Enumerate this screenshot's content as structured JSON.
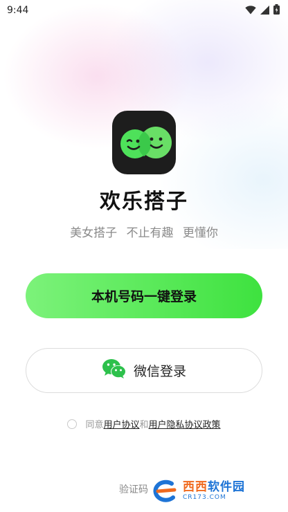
{
  "status_bar": {
    "time": "9:44",
    "icons": [
      "wifi-icon",
      "cellular-signal-icon",
      "battery-icon"
    ]
  },
  "app": {
    "logo": "app-logo-two-smiley-faces",
    "name": "欢乐搭子",
    "tagline": "美女搭子 不止有趣 更懂你"
  },
  "buttons": {
    "phone_login": "本机号码一键登录",
    "wechat_login": "微信登录",
    "wechat_icon": "wechat-icon"
  },
  "agreement": {
    "prefix": "同意",
    "user_agreement": "用户协议",
    "and": "和",
    "privacy_policy": "用户隐私协议政策"
  },
  "footer": {
    "code_login": "验证码"
  },
  "watermark": {
    "title_part1": "西西",
    "title_part2": "软件园",
    "subtitle": "CR173.COM"
  },
  "colors": {
    "primary_green_start": "#7cf27a",
    "primary_green_end": "#3ee23f",
    "logo_bg": "#1d1d1d",
    "wechat_green": "#2dc14c"
  }
}
